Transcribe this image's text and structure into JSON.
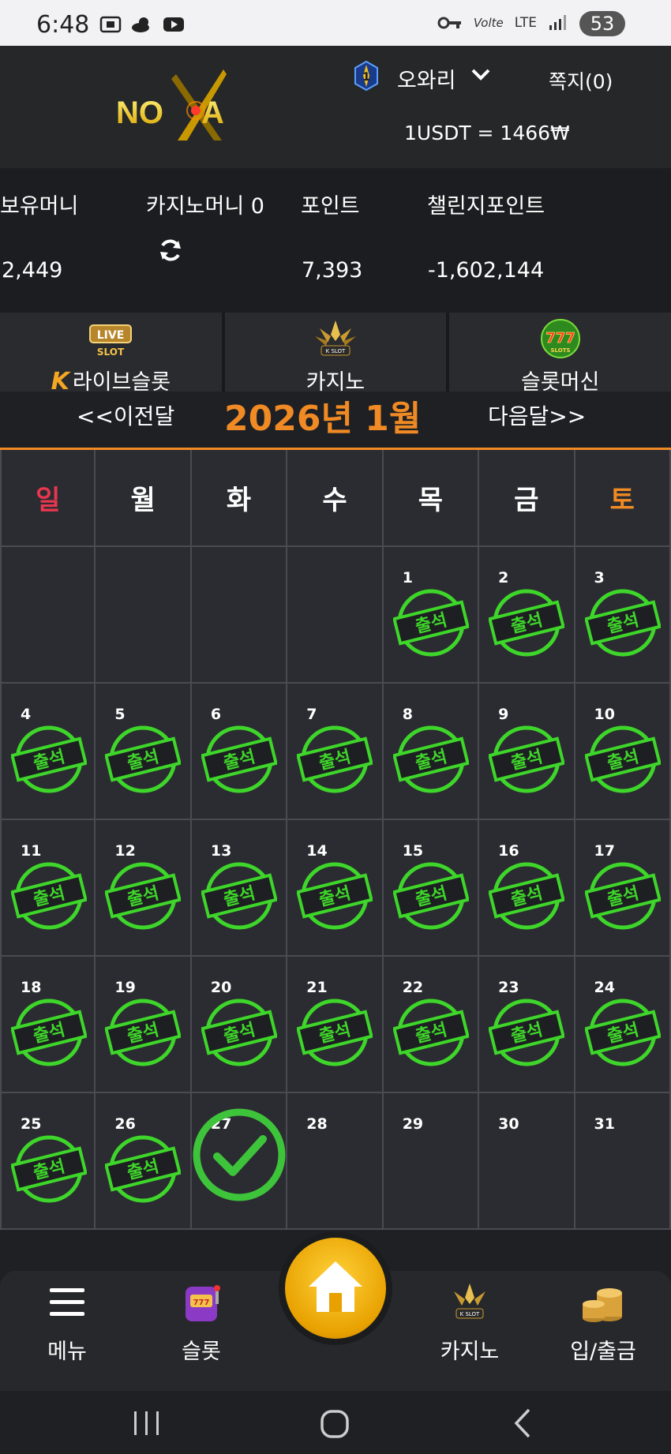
{
  "status_bar": {
    "time": "6:48",
    "network": "LTE",
    "volte": "Volte",
    "battery": "53"
  },
  "header": {
    "logo_text": "NOVA",
    "username": "오와리",
    "rank": "1",
    "messages": "쪽지(0)",
    "exchange_rate": "1USDT = 1466₩"
  },
  "money": {
    "hold_label": "보유머니",
    "hold_value": "2,449",
    "casino_label": "카지노머니 0",
    "point_label": "포인트",
    "point_value": "7,393",
    "challenge_label": "챌린지포인트",
    "challenge_value": "-1,602,144"
  },
  "categories": [
    {
      "label": "라이브슬롯",
      "icon": "live-slot-icon"
    },
    {
      "label": "카지노",
      "icon": "k-slot-crown-icon"
    },
    {
      "label": "슬롯머신",
      "icon": "777-slots-icon"
    }
  ],
  "month_nav": {
    "prev": "<<이전달",
    "title": "2026년 1월",
    "next": "다음달>>"
  },
  "calendar": {
    "weekdays": [
      "일",
      "월",
      "화",
      "수",
      "목",
      "금",
      "토"
    ],
    "stamp_text": "출석",
    "weeks": [
      [
        {
          "d": "",
          "s": 0
        },
        {
          "d": "",
          "s": 0
        },
        {
          "d": "",
          "s": 0
        },
        {
          "d": "",
          "s": 0
        },
        {
          "d": "1",
          "s": 1
        },
        {
          "d": "2",
          "s": 1
        },
        {
          "d": "3",
          "s": 1
        }
      ],
      [
        {
          "d": "4",
          "s": 1
        },
        {
          "d": "5",
          "s": 1
        },
        {
          "d": "6",
          "s": 1
        },
        {
          "d": "7",
          "s": 1
        },
        {
          "d": "8",
          "s": 1
        },
        {
          "d": "9",
          "s": 1
        },
        {
          "d": "10",
          "s": 1
        }
      ],
      [
        {
          "d": "11",
          "s": 1
        },
        {
          "d": "12",
          "s": 1
        },
        {
          "d": "13",
          "s": 1
        },
        {
          "d": "14",
          "s": 1
        },
        {
          "d": "15",
          "s": 1
        },
        {
          "d": "16",
          "s": 1
        },
        {
          "d": "17",
          "s": 1
        }
      ],
      [
        {
          "d": "18",
          "s": 1
        },
        {
          "d": "19",
          "s": 1
        },
        {
          "d": "20",
          "s": 1
        },
        {
          "d": "21",
          "s": 1
        },
        {
          "d": "22",
          "s": 1
        },
        {
          "d": "23",
          "s": 1
        },
        {
          "d": "24",
          "s": 1
        }
      ],
      [
        {
          "d": "25",
          "s": 1
        },
        {
          "d": "26",
          "s": 1
        },
        {
          "d": "27",
          "s": 2
        },
        {
          "d": "28",
          "s": 0
        },
        {
          "d": "29",
          "s": 0
        },
        {
          "d": "30",
          "s": 0
        },
        {
          "d": "31",
          "s": 0
        }
      ]
    ]
  },
  "bottom_nav": {
    "menu": "메뉴",
    "slot": "슬롯",
    "home": "home-icon",
    "casino": "카지노",
    "deposit": "입/출금"
  },
  "colors": {
    "accent": "#f08a24",
    "sunday": "#e8364f",
    "stamp_green": "#3ed62a",
    "check_green": "#3ec43a"
  }
}
